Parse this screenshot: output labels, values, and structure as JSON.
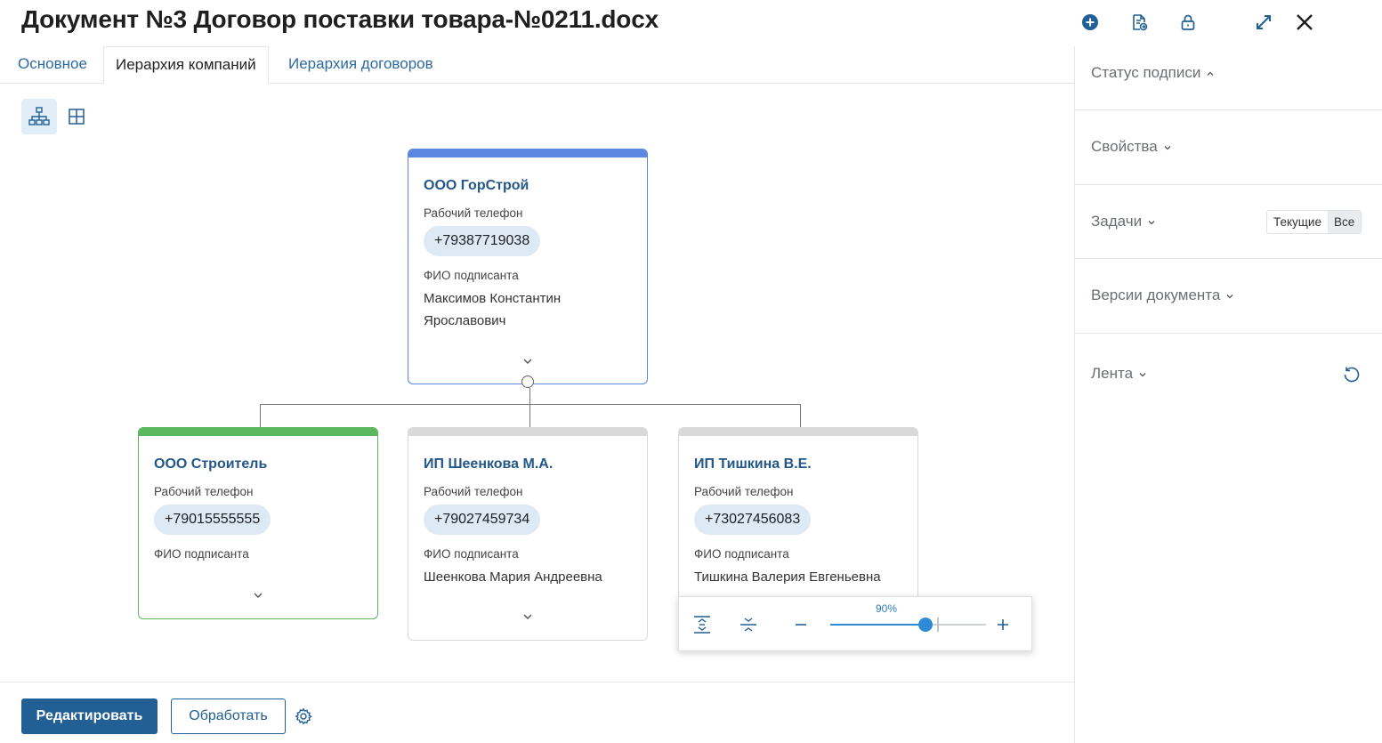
{
  "header": {
    "title": "Документ №3 Договор поставки товара-№0211.docx",
    "icons": [
      "add-circle-icon",
      "document-export-icon",
      "lock-icon",
      "expand-icon",
      "close-icon"
    ]
  },
  "tabs": [
    {
      "label": "Основное",
      "active": false
    },
    {
      "label": "Иерархия компаний",
      "active": true
    },
    {
      "label": "Иерархия договоров",
      "active": false
    }
  ],
  "view_toggles": [
    {
      "icon": "hierarchy-view-icon",
      "active": true
    },
    {
      "icon": "table-view-icon",
      "active": false
    }
  ],
  "hierarchy": {
    "root": {
      "name": "ООО ГорСтрой",
      "bar_color": "#5b87e0",
      "phone_label": "Рабочий телефон",
      "phone": "+79387719038",
      "signer_label": "ФИО подписанта",
      "signer": "Максимов Константин Ярославович"
    },
    "children": [
      {
        "name": "ООО Строитель",
        "bar_color": "#5cb85c",
        "phone_label": "Рабочий телефон",
        "phone": "+79015555555",
        "signer_label": "ФИО подписанта",
        "signer": ""
      },
      {
        "name": "ИП Шеенкова М.А.",
        "bar_color": "#d9d9d9",
        "phone_label": "Рабочий телефон",
        "phone": "+79027459734",
        "signer_label": "ФИО подписанта",
        "signer": "Шеенкова Мария Андреевна"
      },
      {
        "name": "ИП Тишкина В.Е.",
        "bar_color": "#d9d9d9",
        "phone_label": "Рабочий телефон",
        "phone": "+73027456083",
        "signer_label": "ФИО подписанта",
        "signer": "Тишкина Валерия Евгеньевна"
      }
    ]
  },
  "zoom": {
    "value_label": "90%",
    "value": 0.9,
    "min": 0.1,
    "max": 2.0,
    "default": 1.0
  },
  "footer": {
    "edit_label": "Редактировать",
    "process_label": "Обработать"
  },
  "right_panel": {
    "sections": [
      {
        "title": "Статус подписи",
        "expanded": true
      },
      {
        "title": "Свойства",
        "expanded": false
      },
      {
        "title": "Задачи",
        "expanded": false
      },
      {
        "title": "Версии документа",
        "expanded": false
      },
      {
        "title": "Лента",
        "expanded": false
      }
    ],
    "tasks_filter": [
      {
        "label": "Текущие",
        "active": false
      },
      {
        "label": "Все",
        "active": true
      }
    ]
  },
  "colors": {
    "primary": "#225f95",
    "link": "#2c6aa0",
    "accent": "#2d8ad6"
  }
}
